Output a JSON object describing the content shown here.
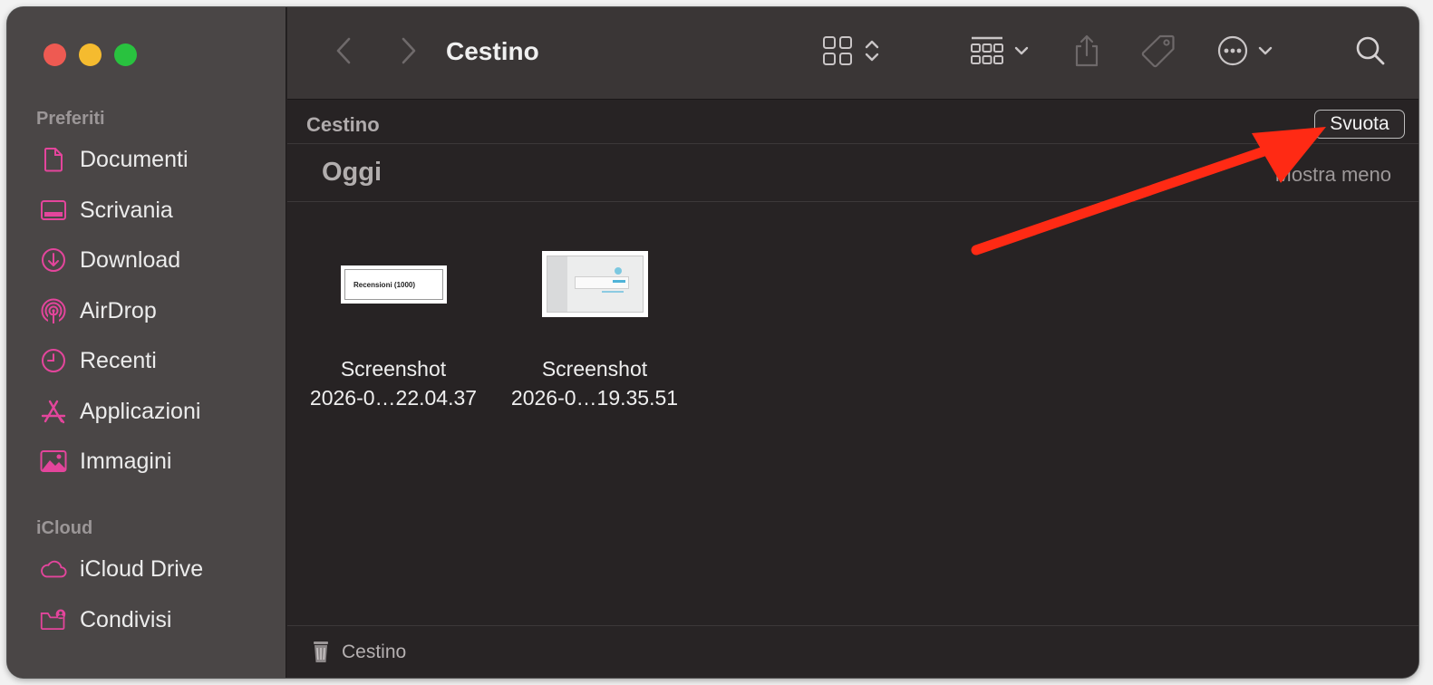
{
  "window": {
    "title": "Cestino"
  },
  "sidebar": {
    "favorites_header": "Preferiti",
    "favorites": [
      {
        "label": "Documenti",
        "icon": "document-icon"
      },
      {
        "label": "Scrivania",
        "icon": "desktop-icon"
      },
      {
        "label": "Download",
        "icon": "download-icon"
      },
      {
        "label": "AirDrop",
        "icon": "airdrop-icon"
      },
      {
        "label": "Recenti",
        "icon": "clock-icon"
      },
      {
        "label": "Applicazioni",
        "icon": "applications-icon"
      },
      {
        "label": "Immagini",
        "icon": "photo-icon"
      }
    ],
    "icloud_header": "iCloud",
    "icloud": [
      {
        "label": "iCloud Drive",
        "icon": "cloud-icon"
      },
      {
        "label": "Condivisi",
        "icon": "shared-folder-icon"
      }
    ]
  },
  "path": {
    "title": "Cestino",
    "empty_button": "Svuota"
  },
  "group": {
    "title": "Oggi",
    "toggle": "Mostra meno"
  },
  "files": [
    {
      "line1": "Screenshot",
      "line2": "2026-0…22.04.37",
      "thumb_text": "Recensioni (1000)"
    },
    {
      "line1": "Screenshot",
      "line2": "2026-0…19.35.51"
    }
  ],
  "status": {
    "text": "Cestino"
  },
  "colors": {
    "accent": "#e4459c",
    "arrow": "#ff2a14"
  }
}
